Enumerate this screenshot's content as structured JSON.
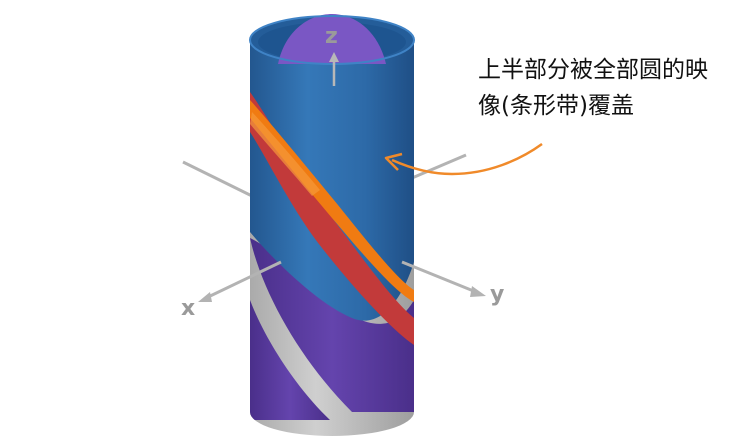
{
  "axes": {
    "z_label": "z",
    "x_label": "x",
    "y_label": "y"
  },
  "annotation": {
    "line1": "上半部分被全部圆的映",
    "line2": "像(条形带)覆盖"
  },
  "colors": {
    "cylinder_blue": "#2f6fae",
    "cylinder_blue_dark": "#1f4f86",
    "inner_purple": "#7a57c4",
    "lower_purple": "#5a3a9e",
    "lower_gray": "#bfbfbf",
    "red_band": "#c23a3a",
    "orange_band": "#f07b12",
    "axis_gray": "#a8a8a8",
    "arrow_orange": "#f08a2a"
  }
}
